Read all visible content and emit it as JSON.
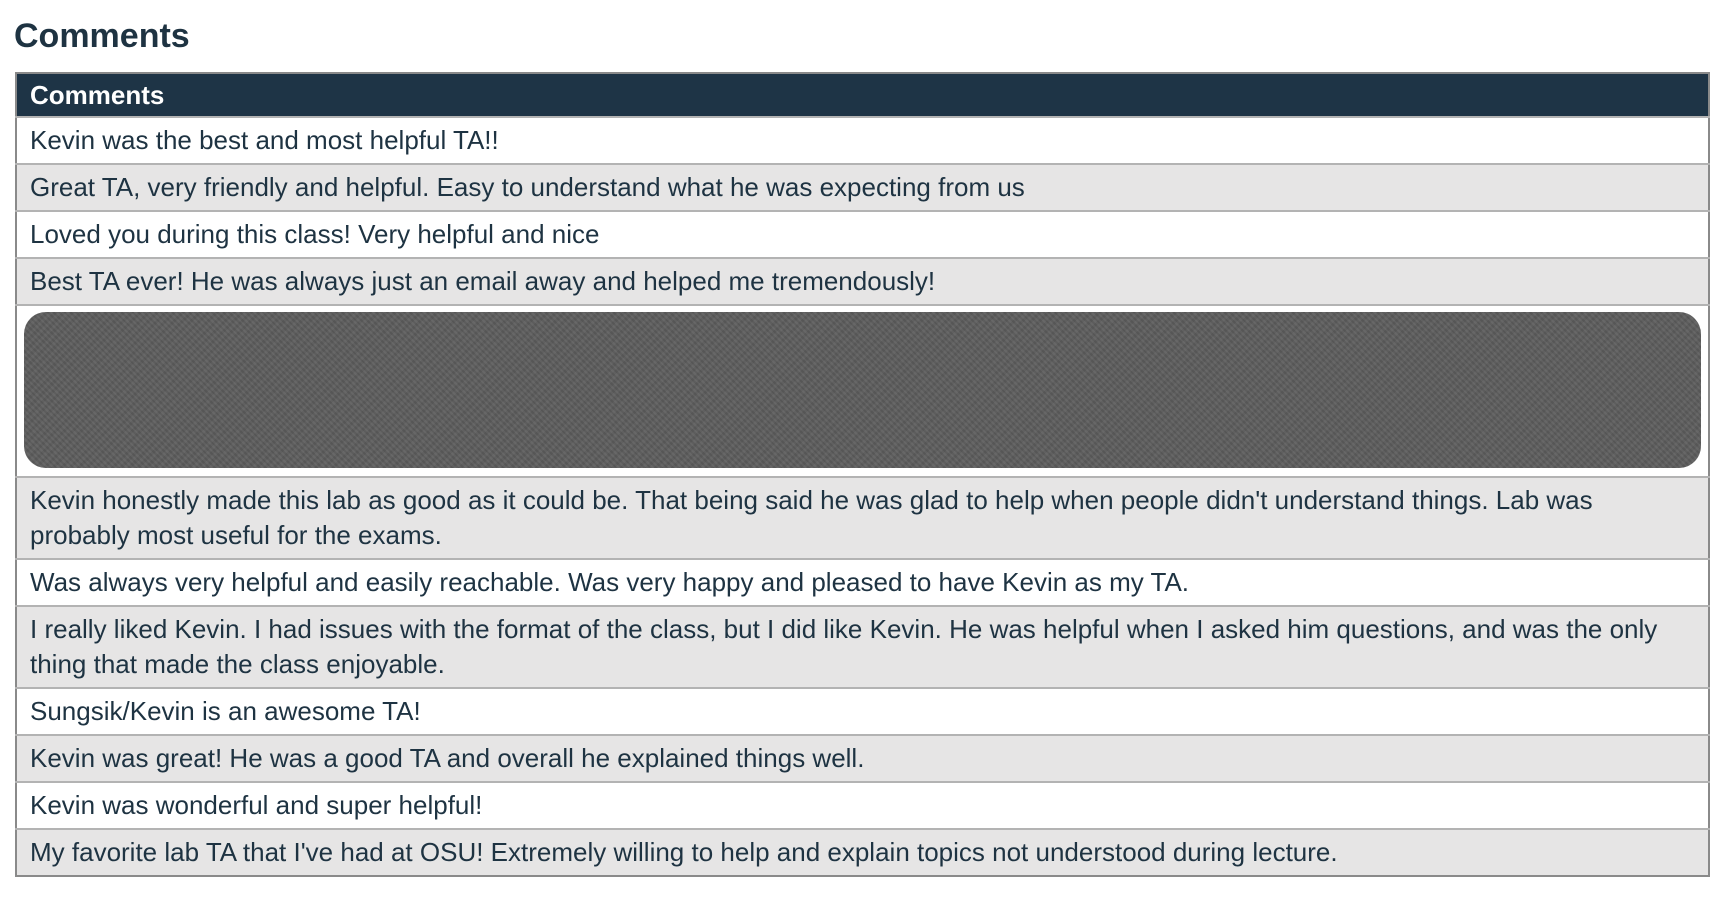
{
  "page": {
    "section_title": "Comments"
  },
  "table": {
    "header": "Comments",
    "rows": [
      "Kevin was the best and most helpful TA!!",
      "Great TA, very friendly and helpful. Easy to understand what he was expecting from us",
      "Loved you during this class! Very helpful and nice",
      "Best TA ever! He was always just an email away and helped me tremendously!",
      "Kevin honestly made this lab as good as it could be. That being said he was glad to help when people didn't understand things. Lab was probably most useful for the exams.",
      "Was always very helpful and easily reachable. Was very happy and pleased to have Kevin as my TA.",
      "I really liked Kevin. I had issues with the format of the class, but I did like Kevin. He was helpful when I asked him questions, and was the only thing that made the class enjoyable.",
      "Sungsik/Kevin is an awesome TA!",
      "Kevin was great! He was a good TA and overall he explained things well.",
      "Kevin was wonderful and super helpful!",
      "My favorite lab TA that I've had at OSU! Extremely willing to help and explain topics not understood during lecture."
    ]
  },
  "colors": {
    "header_bg": "#1e3446",
    "text": "#1e3342",
    "row_alt": "#e6e5e5",
    "redaction": "#5e5e5e"
  }
}
